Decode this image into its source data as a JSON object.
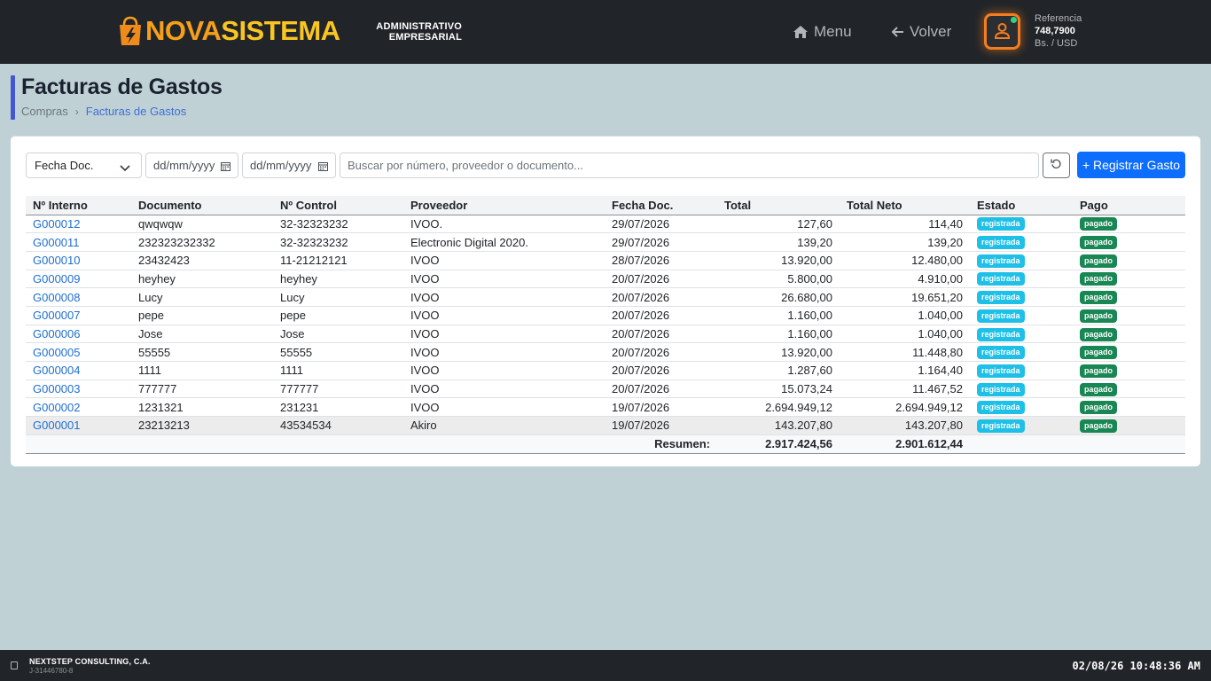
{
  "brand": {
    "name_part1": "NOVA",
    "name_part2": "SISTEMA",
    "subtitle_line1": "ADMINISTRATIVO",
    "subtitle_line2": "EMPRESARIAL",
    "colors": {
      "orange": "#f6a01a",
      "yellow": "#f9c523"
    }
  },
  "nav": {
    "menu_label": "Menu",
    "back_label": "Volver",
    "menu_icon": "home-icon",
    "back_icon": "arrow-left-icon"
  },
  "reference": {
    "label": "Referencia",
    "value": "748,7900",
    "unit": "Bs. / USD"
  },
  "page": {
    "title": "Facturas de Gastos",
    "breadcrumb": [
      "Compras",
      "Facturas de Gastos"
    ]
  },
  "filters": {
    "date_field_selected": "Fecha Doc.",
    "date_from_placeholder": "dd/mm/yyyy",
    "date_to_placeholder": "dd/mm/yyyy",
    "search_placeholder": "Buscar por número, proveedor o documento...",
    "register_label": "+ Registrar Gasto"
  },
  "table": {
    "columns": [
      "Nº Interno",
      "Documento",
      "Nº Control",
      "Proveedor",
      "Fecha Doc.",
      "Total",
      "Total Neto",
      "Estado",
      "Pago"
    ],
    "rows": [
      {
        "interno": "G000012",
        "documento": "qwqwqw",
        "control": "32-32323232",
        "proveedor": "IVOO.",
        "fecha": "29/07/2026",
        "total": "127,60",
        "neto": "114,40",
        "estado": "registrada",
        "pago": "pagado"
      },
      {
        "interno": "G000011",
        "documento": "232323232332",
        "control": "32-32323232",
        "proveedor": "Electronic Digital 2020.",
        "fecha": "29/07/2026",
        "total": "139,20",
        "neto": "139,20",
        "estado": "registrada",
        "pago": "pagado"
      },
      {
        "interno": "G000010",
        "documento": "23432423",
        "control": "11-21212121",
        "proveedor": "IVOO",
        "fecha": "28/07/2026",
        "total": "13.920,00",
        "neto": "12.480,00",
        "estado": "registrada",
        "pago": "pagado"
      },
      {
        "interno": "G000009",
        "documento": "heyhey",
        "control": "heyhey",
        "proveedor": "IVOO",
        "fecha": "20/07/2026",
        "total": "5.800,00",
        "neto": "4.910,00",
        "estado": "registrada",
        "pago": "pagado"
      },
      {
        "interno": "G000008",
        "documento": "Lucy",
        "control": "Lucy",
        "proveedor": "IVOO",
        "fecha": "20/07/2026",
        "total": "26.680,00",
        "neto": "19.651,20",
        "estado": "registrada",
        "pago": "pagado"
      },
      {
        "interno": "G000007",
        "documento": "pepe",
        "control": "pepe",
        "proveedor": "IVOO",
        "fecha": "20/07/2026",
        "total": "1.160,00",
        "neto": "1.040,00",
        "estado": "registrada",
        "pago": "pagado"
      },
      {
        "interno": "G000006",
        "documento": "Jose",
        "control": "Jose",
        "proveedor": "IVOO",
        "fecha": "20/07/2026",
        "total": "1.160,00",
        "neto": "1.040,00",
        "estado": "registrada",
        "pago": "pagado"
      },
      {
        "interno": "G000005",
        "documento": "55555",
        "control": "55555",
        "proveedor": "IVOO",
        "fecha": "20/07/2026",
        "total": "13.920,00",
        "neto": "11.448,80",
        "estado": "registrada",
        "pago": "pagado"
      },
      {
        "interno": "G000004",
        "documento": "1111",
        "control": "1111",
        "proveedor": "IVOO",
        "fecha": "20/07/2026",
        "total": "1.287,60",
        "neto": "1.164,40",
        "estado": "registrada",
        "pago": "pagado"
      },
      {
        "interno": "G000003",
        "documento": "777777",
        "control": "777777",
        "proveedor": "IVOO",
        "fecha": "20/07/2026",
        "total": "15.073,24",
        "neto": "11.467,52",
        "estado": "registrada",
        "pago": "pagado"
      },
      {
        "interno": "G000002",
        "documento": "1231321",
        "control": "231231",
        "proveedor": "IVOO",
        "fecha": "19/07/2026",
        "total": "2.694.949,12",
        "neto": "2.694.949,12",
        "estado": "registrada",
        "pago": "pagado"
      },
      {
        "interno": "G000001",
        "documento": "23213213",
        "control": "43534534",
        "proveedor": "Akiro",
        "fecha": "19/07/2026",
        "total": "143.207,80",
        "neto": "143.207,80",
        "estado": "registrada",
        "pago": "pagado"
      }
    ],
    "summary": {
      "label": "Resumen:",
      "total": "2.917.424,56",
      "neto": "2.901.612,44"
    }
  },
  "footer": {
    "company": "NEXTSTEP CONSULTING, C.A.",
    "rif": "J-31446780-8",
    "datetime": "02/08/26 10:48:36 AM"
  }
}
